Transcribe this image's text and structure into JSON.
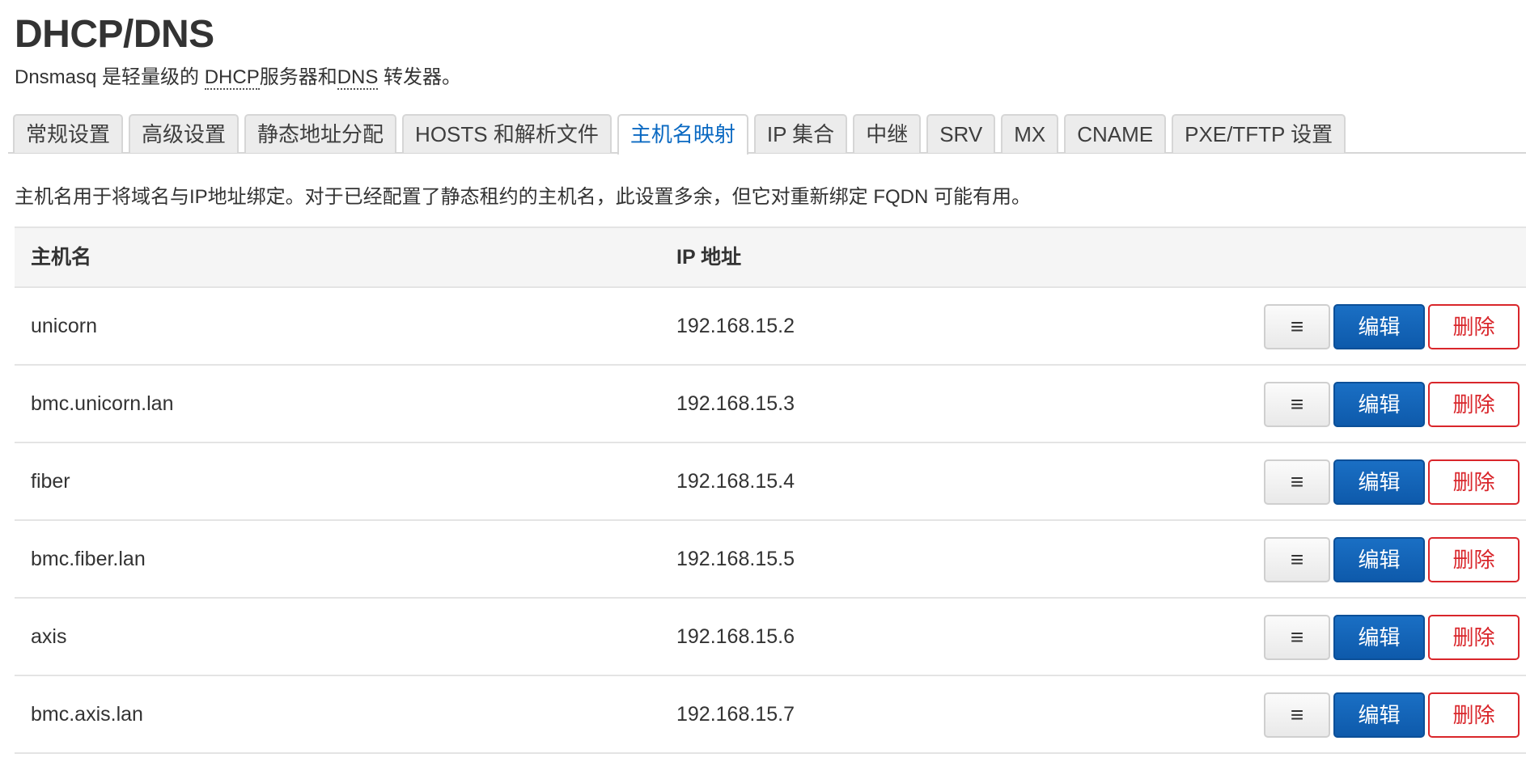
{
  "page": {
    "title": "DHCP/DNS",
    "description_prefix": "Dnsmasq 是轻量级的 ",
    "description_abbr1": "DHCP",
    "description_mid": "服务器和",
    "description_abbr2": "DNS",
    "description_suffix": " 转发器。"
  },
  "tabs": [
    {
      "label": "常规设置",
      "active": false
    },
    {
      "label": "高级设置",
      "active": false
    },
    {
      "label": "静态地址分配",
      "active": false
    },
    {
      "label": "HOSTS 和解析文件",
      "active": false
    },
    {
      "label": "主机名映射",
      "active": true
    },
    {
      "label": "IP 集合",
      "active": false
    },
    {
      "label": "中继",
      "active": false
    },
    {
      "label": "SRV",
      "active": false
    },
    {
      "label": "MX",
      "active": false
    },
    {
      "label": "CNAME",
      "active": false
    },
    {
      "label": "PXE/TFTP 设置",
      "active": false
    }
  ],
  "section": {
    "description": "主机名用于将域名与IP地址绑定。对于已经配置了静态租约的主机名，此设置多余，但它对重新绑定 FQDN 可能有用。"
  },
  "table": {
    "headers": {
      "hostname": "主机名",
      "ip": "IP 地址"
    },
    "rows": [
      {
        "hostname": "unicorn",
        "ip": "192.168.15.2"
      },
      {
        "hostname": "bmc.unicorn.lan",
        "ip": "192.168.15.3"
      },
      {
        "hostname": "fiber",
        "ip": "192.168.15.4"
      },
      {
        "hostname": "bmc.fiber.lan",
        "ip": "192.168.15.5"
      },
      {
        "hostname": "axis",
        "ip": "192.168.15.6"
      },
      {
        "hostname": "bmc.axis.lan",
        "ip": "192.168.15.7"
      }
    ],
    "actions": {
      "drag_icon": "≡",
      "edit_label": "编辑",
      "delete_label": "删除"
    }
  },
  "colors": {
    "accent": "#0a69c2",
    "edit_button": "#0e5aab",
    "delete_button": "#d9262b"
  }
}
